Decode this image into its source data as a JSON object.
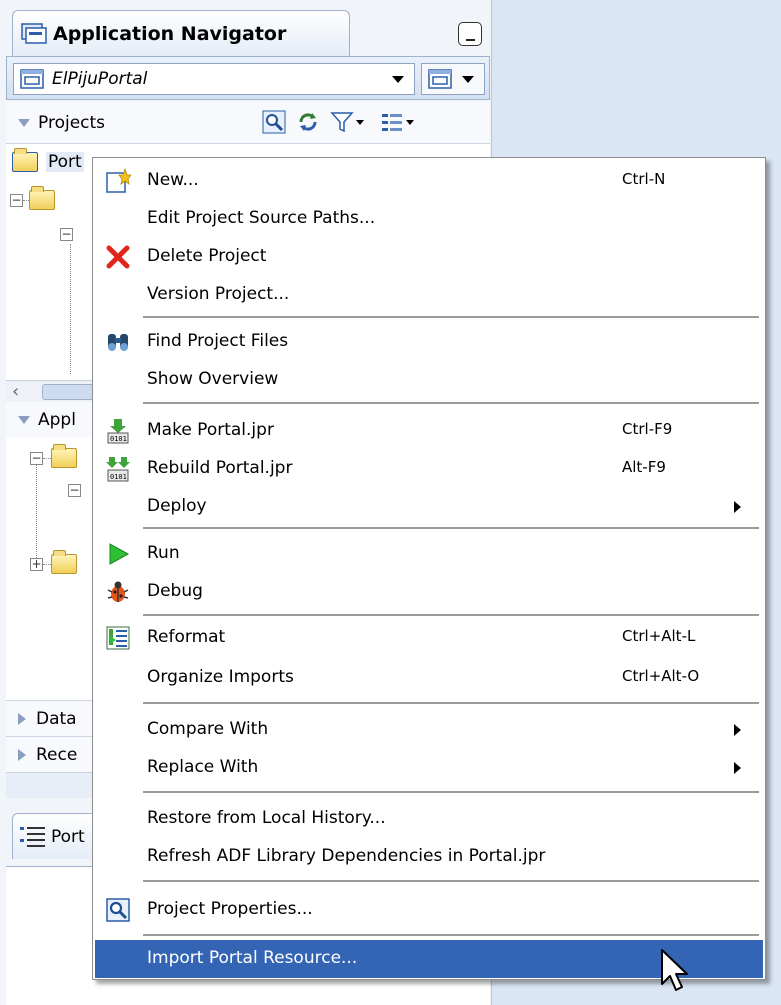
{
  "navigator": {
    "title": "Application Navigator",
    "application": "ElPijuPortal",
    "sections": {
      "projects": "Projects",
      "project_node": "Port",
      "application_resources": "Appl",
      "data_controls": "Data",
      "recently_opened": "Rece"
    },
    "structure_tab": "Port"
  },
  "context_menu": {
    "items": [
      {
        "label": "New...",
        "accel": "Ctrl-N",
        "icon": "new-gallery-icon"
      },
      {
        "label": "Edit Project Source Paths...",
        "accel": ""
      },
      {
        "label": "Delete Project",
        "accel": "",
        "icon": "delete-icon"
      },
      {
        "label": "Version Project...",
        "accel": ""
      },
      {
        "label": "Find Project Files",
        "accel": "",
        "icon": "binoculars-icon"
      },
      {
        "label": "Show Overview",
        "accel": ""
      },
      {
        "label": "Make Portal.jpr",
        "accel": "Ctrl-F9",
        "icon": "make-icon"
      },
      {
        "label": "Rebuild Portal.jpr",
        "accel": "Alt-F9",
        "icon": "rebuild-icon"
      },
      {
        "label": "Deploy",
        "accel": ""
      },
      {
        "label": "Run",
        "accel": "",
        "icon": "run-icon"
      },
      {
        "label": "Debug",
        "accel": "",
        "icon": "debug-icon"
      },
      {
        "label": "Reformat",
        "accel": "Ctrl+Alt-L",
        "icon": "reformat-icon"
      },
      {
        "label": "Organize Imports",
        "accel": "Ctrl+Alt-O"
      },
      {
        "label": "Compare With",
        "accel": ""
      },
      {
        "label": "Replace With",
        "accel": ""
      },
      {
        "label": "Restore from Local History...",
        "accel": ""
      },
      {
        "label": "Refresh ADF Library Dependencies in Portal.jpr",
        "accel": ""
      },
      {
        "label": "Project Properties...",
        "accel": "",
        "icon": "properties-icon"
      },
      {
        "label": "Import Portal Resource...",
        "accel": "",
        "highlighted": true
      }
    ]
  },
  "colors": {
    "highlight": "#3465b5",
    "panel_background": "#f1f4f9",
    "desktop_background": "#dbe6f5"
  }
}
